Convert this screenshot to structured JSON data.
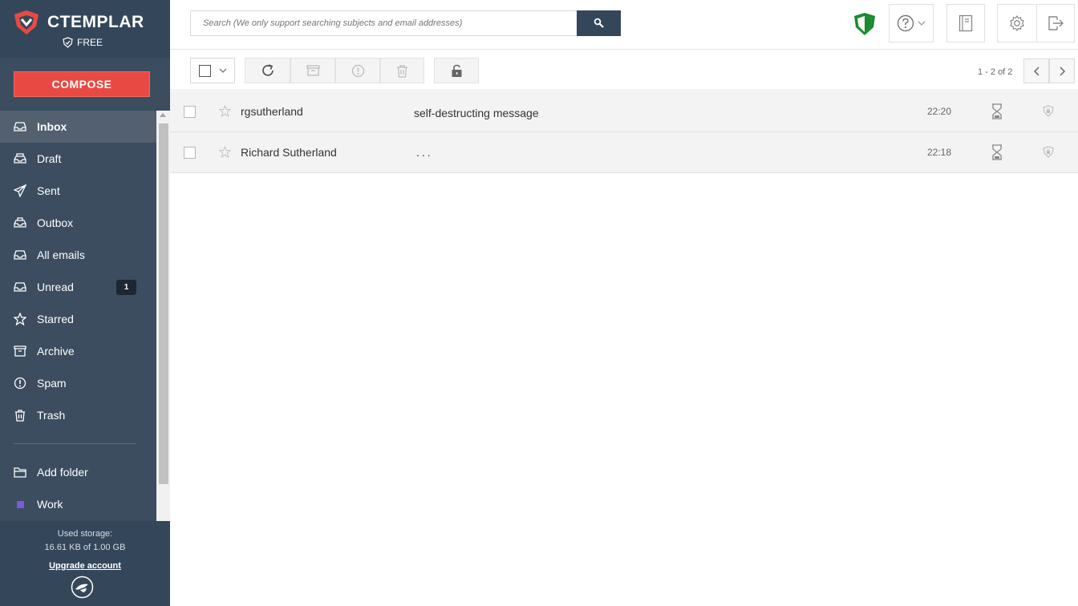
{
  "brand": {
    "name": "CTEMPLAR",
    "plan": "FREE",
    "logo_color": "#e84a43"
  },
  "compose": {
    "label": "COMPOSE",
    "color": "#e84a43"
  },
  "sidebar": {
    "items": [
      {
        "label": "Inbox",
        "icon": "inbox-icon",
        "active": true
      },
      {
        "label": "Draft",
        "icon": "draft-icon"
      },
      {
        "label": "Sent",
        "icon": "send-icon"
      },
      {
        "label": "Outbox",
        "icon": "outbox-icon"
      },
      {
        "label": "All emails",
        "icon": "all-emails-icon"
      },
      {
        "label": "Unread",
        "icon": "unread-icon",
        "badge": "1"
      },
      {
        "label": "Starred",
        "icon": "star-icon"
      },
      {
        "label": "Archive",
        "icon": "archive-icon"
      },
      {
        "label": "Spam",
        "icon": "spam-icon"
      },
      {
        "label": "Trash",
        "icon": "trash-icon"
      }
    ],
    "custom": [
      {
        "label": "Add folder",
        "icon": "folder-icon"
      },
      {
        "label": "Work",
        "icon": "folder-color-square",
        "color": "#7b5cd6"
      }
    ]
  },
  "storage": {
    "title": "Used storage:",
    "usage": "16.61 KB of 1.00 GB",
    "upgrade": "Upgrade account"
  },
  "search": {
    "placeholder": "Search (We only support searching subjects and email addresses)"
  },
  "pager": {
    "text": "1 - 2 of 2"
  },
  "security_color": "#1a8a2e",
  "emails": [
    {
      "sender": "rgsutherland",
      "subject": "self-destructing message",
      "time": "22:20"
    },
    {
      "sender": "Richard Sutherland",
      "subject": "...",
      "time": "22:18"
    }
  ]
}
